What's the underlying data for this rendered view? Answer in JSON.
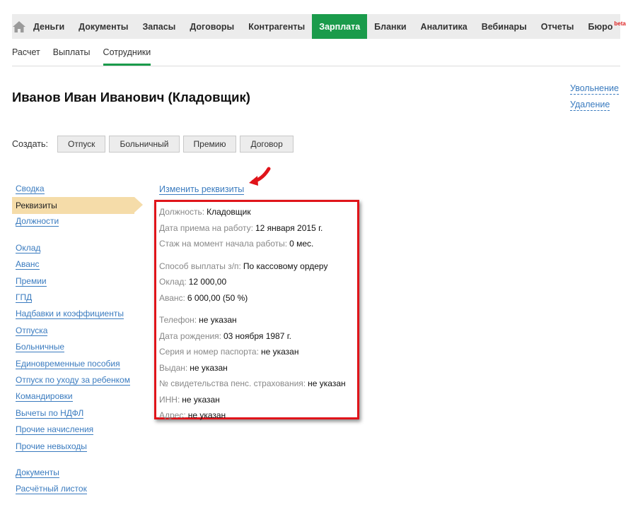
{
  "topnav": {
    "home_icon": "home-icon",
    "items": [
      {
        "label": "Деньги"
      },
      {
        "label": "Документы"
      },
      {
        "label": "Запасы"
      },
      {
        "label": "Договоры"
      },
      {
        "label": "Контрагенты"
      },
      {
        "label": "Зарплата",
        "active": true
      },
      {
        "label": "Бланки"
      },
      {
        "label": "Аналитика"
      },
      {
        "label": "Вебинары"
      },
      {
        "label": "Отчеты"
      },
      {
        "label": "Бюро",
        "badge": "beta"
      }
    ],
    "accent_color": "#1a9b4b"
  },
  "subnav": {
    "items": [
      {
        "label": "Расчет"
      },
      {
        "label": "Выплаты"
      },
      {
        "label": "Сотрудники",
        "active": true
      }
    ]
  },
  "employee": {
    "title": "Иванов Иван Иванович (Кладовщик)"
  },
  "actions": {
    "dismiss": "Увольнение",
    "delete": "Удаление"
  },
  "create": {
    "label": "Создать:",
    "buttons": [
      "Отпуск",
      "Больничный",
      "Премию",
      "Договор"
    ]
  },
  "leftmenu": {
    "groups": [
      [
        "Сводка",
        "Реквизиты",
        "Должности"
      ],
      [
        "Оклад",
        "Аванс",
        "Премии",
        "ГПД",
        "Надбавки и коэффициенты",
        "Отпуска",
        "Больничные",
        "Единовременные пособия",
        "Отпуск по уходу за ребенком",
        "Командировки",
        "Вычеты по НДФЛ",
        "Прочие начисления",
        "Прочие невыходы"
      ],
      [
        "Документы",
        "Расчётный листок"
      ]
    ],
    "active": "Реквизиты"
  },
  "details": {
    "edit_link": "Изменить реквизиты",
    "groups": [
      [
        {
          "label": "Должность:",
          "value": "Кладовщик"
        },
        {
          "label": "Дата приема на работу:",
          "value": "12 января 2015 г."
        },
        {
          "label": "Стаж на момент начала работы:",
          "value": "0 мес."
        }
      ],
      [
        {
          "label": "Способ выплаты з/п:",
          "value": "По кассовому ордеру"
        },
        {
          "label": "Оклад:",
          "value": "12 000,00"
        },
        {
          "label": "Аванс:",
          "value": "6 000,00 (50 %)"
        }
      ],
      [
        {
          "label": "Телефон:",
          "value": "не указан"
        },
        {
          "label": "Дата рождения:",
          "value": "03 ноября 1987 г."
        },
        {
          "label": "Серия и номер паспорта:",
          "value": "не указан"
        },
        {
          "label": "Выдан:",
          "value": "не указан"
        },
        {
          "label": "№ свидетельства пенс. страхования:",
          "value": "не указан"
        },
        {
          "label": "ИНН:",
          "value": "не указан"
        },
        {
          "label": "Адрес:",
          "value": "не указан"
        }
      ]
    ],
    "highlight_color": "#e0141a",
    "arrow_icon": "red-arrow-icon"
  }
}
